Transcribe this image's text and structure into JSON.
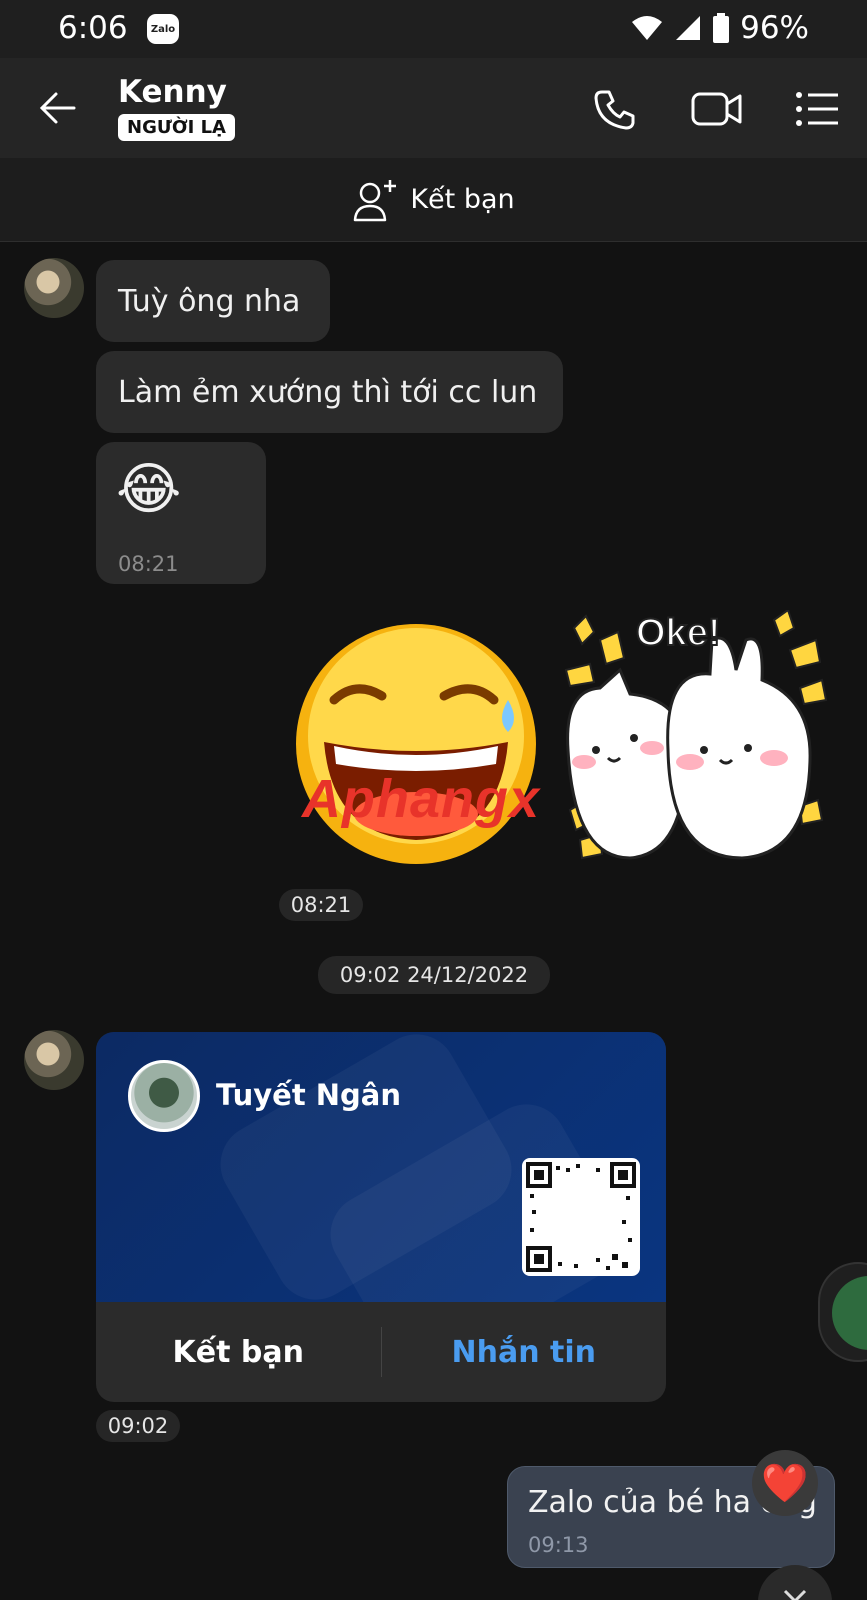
{
  "status_bar": {
    "time": "6:06",
    "app_badge": "Zalo",
    "battery_text": "96%",
    "icons": [
      "wifi-icon",
      "signal-icon",
      "battery-icon"
    ]
  },
  "header": {
    "contact_name": "Kenny",
    "stranger_badge": "NGƯỜI LẠ",
    "icons": [
      "back-arrow-icon",
      "phone-icon",
      "video-call-icon",
      "menu-list-icon"
    ]
  },
  "add_friend_bar": {
    "label": "Kết bạn",
    "icon": "add-user-icon"
  },
  "messages": {
    "m1": {
      "text": "Tuỳ ông nha"
    },
    "m2": {
      "text": "Làm ẻm xướng thì tới cc lun"
    },
    "m3": {
      "emoji": "😂",
      "time": "08:21"
    },
    "stickers": {
      "sticker2_text": "Oke!",
      "time": "08:21",
      "watermark": "Aphangx"
    },
    "date_divider": "09:02 24/12/2022",
    "contact_card": {
      "name": "Tuyết Ngân",
      "add_friend_label": "Kết bạn",
      "message_label": "Nhắn tin",
      "time": "09:02"
    },
    "outgoing": {
      "text": "Zalo của bé ha ông",
      "time": "09:13",
      "reaction": "❤️"
    }
  },
  "colors": {
    "background": "#121212",
    "bubble_in": "#2b2b2b",
    "bubble_out": "#3a4250",
    "card_blue": "#0c2a63",
    "link_blue": "#4a9cf0"
  }
}
